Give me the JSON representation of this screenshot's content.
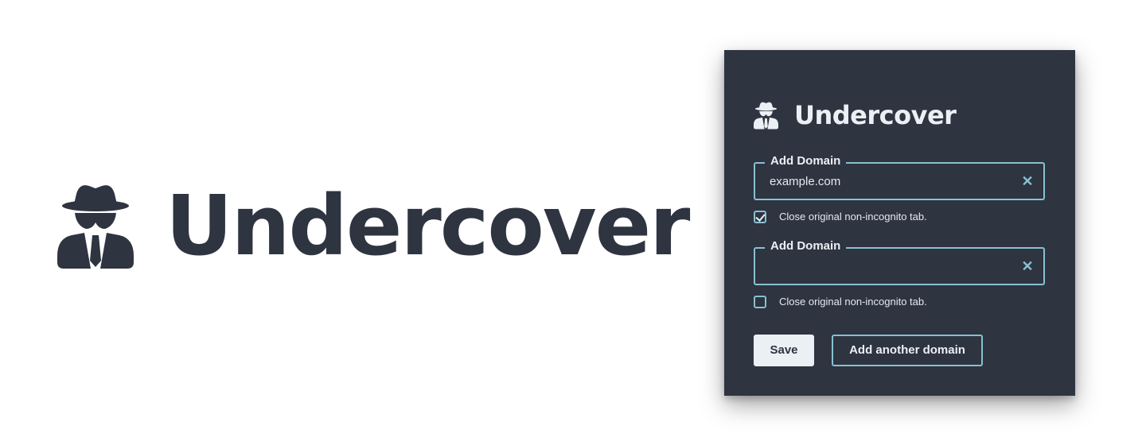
{
  "brand": {
    "name": "Undercover",
    "icon": "spy-icon",
    "color": "#2e3440"
  },
  "popup": {
    "title": "Undercover",
    "icon": "spy-icon",
    "background": "#2e3440",
    "accent": "#88c0d0",
    "text_color": "#eceff4",
    "domains": [
      {
        "legend": "Add Domain",
        "value": "example.com",
        "clear_icon": "close-icon",
        "checkbox_checked": true,
        "checkbox_label": "Close original non-incognito tab."
      },
      {
        "legend": "Add Domain",
        "value": "",
        "clear_icon": "close-icon",
        "checkbox_checked": false,
        "checkbox_label": "Close original non-incognito tab."
      }
    ],
    "buttons": {
      "save_label": "Save",
      "add_label": "Add another domain"
    }
  }
}
